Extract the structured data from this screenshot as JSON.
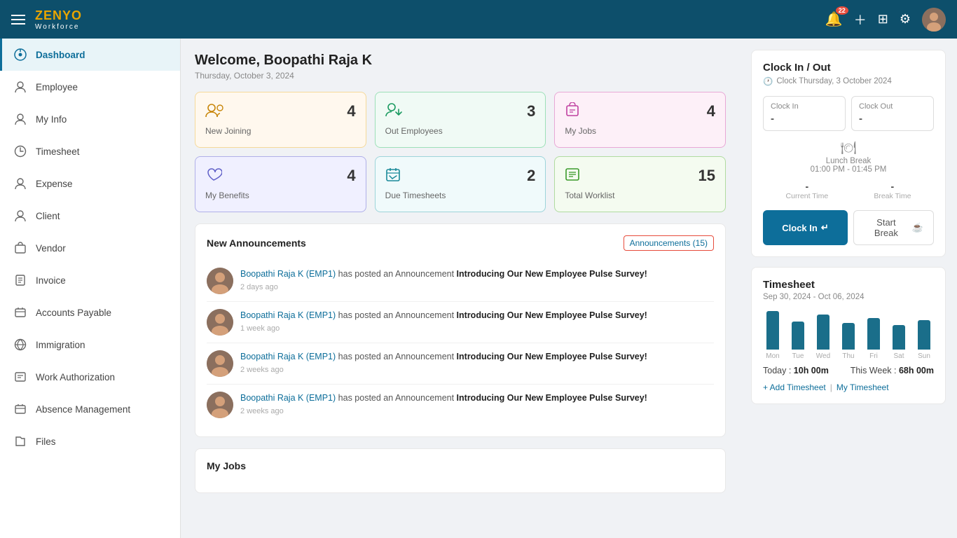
{
  "header": {
    "menu_icon": "☰",
    "logo_primary": "ZENYO",
    "logo_secondary": "Workforce",
    "notification_count": "22",
    "add_icon": "+",
    "grid_icon": "⊞",
    "settings_icon": "⚙"
  },
  "sidebar": {
    "items": [
      {
        "id": "dashboard",
        "label": "Dashboard",
        "active": true
      },
      {
        "id": "employee",
        "label": "Employee",
        "active": false
      },
      {
        "id": "my-info",
        "label": "My Info",
        "active": false
      },
      {
        "id": "timesheet",
        "label": "Timesheet",
        "active": false
      },
      {
        "id": "expense",
        "label": "Expense",
        "active": false
      },
      {
        "id": "client",
        "label": "Client",
        "active": false
      },
      {
        "id": "vendor",
        "label": "Vendor",
        "active": false
      },
      {
        "id": "invoice",
        "label": "Invoice",
        "active": false
      },
      {
        "id": "accounts-payable",
        "label": "Accounts Payable",
        "active": false
      },
      {
        "id": "immigration",
        "label": "Immigration",
        "active": false
      },
      {
        "id": "work-authorization",
        "label": "Work Authorization",
        "active": false
      },
      {
        "id": "absence-management",
        "label": "Absence Management",
        "active": false
      },
      {
        "id": "files",
        "label": "Files",
        "active": false
      }
    ]
  },
  "welcome": {
    "title": "Welcome, Boopathi Raja K",
    "date": "Thursday, October 3, 2024"
  },
  "stat_cards": [
    {
      "id": "new-joining",
      "label": "New Joining",
      "value": "4",
      "color": "orange",
      "icon": "👥"
    },
    {
      "id": "out-employees",
      "label": "Out Employees",
      "value": "3",
      "color": "green",
      "icon": "👤"
    },
    {
      "id": "my-jobs",
      "label": "My Jobs",
      "value": "4",
      "color": "pink",
      "icon": "📋"
    },
    {
      "id": "my-benefits",
      "label": "My Benefits",
      "value": "4",
      "color": "blue",
      "icon": "🤲"
    },
    {
      "id": "due-timesheets",
      "label": "Due Timesheets",
      "value": "2",
      "color": "teal",
      "icon": "📅"
    },
    {
      "id": "total-worklist",
      "label": "Total Worklist",
      "value": "15",
      "color": "lightgreen",
      "icon": "📊"
    }
  ],
  "announcements": {
    "section_title": "New Announcements",
    "link_label": "Announcements (15)",
    "items": [
      {
        "id": 1,
        "author": "Boopathi Raja K (EMP1)",
        "text_prefix": " has posted an Announcement ",
        "bold_text": "Introducing Our New Employee Pulse Survey!",
        "time": "2 days ago"
      },
      {
        "id": 2,
        "author": "Boopathi Raja K (EMP1)",
        "text_prefix": " has posted an Announcement ",
        "bold_text": "Introducing Our New Employee Pulse Survey!",
        "time": "1 week ago"
      },
      {
        "id": 3,
        "author": "Boopathi Raja K (EMP1)",
        "text_prefix": " has posted an Announcement ",
        "bold_text": "Introducing Our New Employee Pulse Survey!",
        "time": "2 weeks ago"
      },
      {
        "id": 4,
        "author": "Boopathi Raja K (EMP1)",
        "text_prefix": " has posted an Announcement ",
        "bold_text": "Introducing Our New Employee Pulse Survey!",
        "time": "2 weeks ago"
      }
    ]
  },
  "my_jobs": {
    "section_title": "My Jobs"
  },
  "clock_panel": {
    "title": "Clock In / Out",
    "date_label": "Clock Thursday, 3 October 2024",
    "clock_in_label": "Clock In",
    "clock_in_value": "-",
    "clock_out_label": "Clock Out",
    "clock_out_value": "-",
    "lunch_icon": "🍽",
    "lunch_title": "Lunch Break",
    "lunch_time": "01:00 PM - 01:45 PM",
    "current_time_label": "Current Time",
    "current_time_value": "-",
    "break_time_label": "Break Time",
    "break_time_value": "-",
    "btn_clock_in": "Clock In",
    "btn_start_break": "Start Break"
  },
  "timesheet_panel": {
    "title": "Timesheet",
    "range": "Sep 30, 2024 - Oct 06, 2024",
    "bars": [
      {
        "day": "Mon",
        "height": 55
      },
      {
        "day": "Tue",
        "height": 40
      },
      {
        "day": "Wed",
        "height": 50
      },
      {
        "day": "Thu",
        "height": 38
      },
      {
        "day": "Fri",
        "height": 45
      },
      {
        "day": "Sat",
        "height": 35
      },
      {
        "day": "Sun",
        "height": 42
      }
    ],
    "today_label": "Today :",
    "today_value": "10h 00m",
    "this_week_label": "This Week :",
    "this_week_value": "68h 00m",
    "add_timesheet": "+ Add Timesheet",
    "my_timesheet": "My Timesheet"
  },
  "colors": {
    "primary": "#0d4f6b",
    "accent": "#0d6e9a",
    "orange_card": "#fff8ee",
    "green_card": "#f0faf5",
    "pink_card": "#fdf0f8",
    "blue_card": "#f0f0ff",
    "teal_card": "#f0fafb",
    "lightgreen_card": "#f4fbf0"
  }
}
